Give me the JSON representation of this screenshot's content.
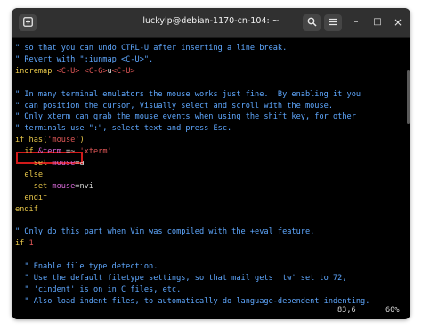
{
  "window": {
    "title": "luckylp@debian-1170-cn-104: ~",
    "new_tab_icon": "plus-box-icon",
    "search_icon": "search-icon",
    "menu_icon": "hamburger-menu-icon",
    "minimize_label": "–",
    "maximize_label": "□",
    "close_label": "×"
  },
  "colors": {
    "comment": "#5fa8ff",
    "keyword": "#e8c84a",
    "string": "#e05757",
    "option": "#d86ad8",
    "highlight_box": "#d11a1a"
  },
  "terminal": {
    "lines": [
      [
        {
          "t": "\" so that you can undo CTRL-U after inserting a line break.",
          "c": "comment"
        }
      ],
      [
        {
          "t": "\" Revert with \":iunmap <C-U>\".",
          "c": "comment"
        }
      ],
      [
        {
          "t": "inoremap",
          "c": "kw"
        },
        {
          "t": " ",
          "c": "op"
        },
        {
          "t": "<C-U>",
          "c": "map"
        },
        {
          "t": " ",
          "c": "op"
        },
        {
          "t": "<C-G>",
          "c": "map"
        },
        {
          "t": "u",
          "c": "op"
        },
        {
          "t": "<C-U>",
          "c": "map"
        }
      ],
      [
        {
          "t": "",
          "c": "op"
        }
      ],
      [
        {
          "t": "\" In many terminal emulators the mouse works just fine.  By enabling it you",
          "c": "comment"
        }
      ],
      [
        {
          "t": "\" can position the cursor, Visually select and scroll with the mouse.",
          "c": "comment"
        }
      ],
      [
        {
          "t": "\" Only xterm can grab the mouse events when using the shift key, for other",
          "c": "comment"
        }
      ],
      [
        {
          "t": "\" terminals use \":\", select text and press Esc.",
          "c": "comment"
        }
      ],
      [
        {
          "t": "if",
          "c": "kw"
        },
        {
          "t": " ",
          "c": "op"
        },
        {
          "t": "has(",
          "c": "kw"
        },
        {
          "t": "'mouse'",
          "c": "str"
        },
        {
          "t": ")",
          "c": "kw"
        }
      ],
      [
        {
          "t": "  if",
          "c": "kw"
        },
        {
          "t": " ",
          "c": "op"
        },
        {
          "t": "&term",
          "c": "var"
        },
        {
          "t": " =~ ",
          "c": "op"
        },
        {
          "t": "'xterm'",
          "c": "str"
        }
      ],
      [
        {
          "t": "    set",
          "c": "kw"
        },
        {
          "t": " ",
          "c": "op"
        },
        {
          "t": "mouse",
          "c": "opt"
        },
        {
          "t": "=a",
          "c": "op"
        }
      ],
      [
        {
          "t": "  else",
          "c": "kw"
        }
      ],
      [
        {
          "t": "    set",
          "c": "kw"
        },
        {
          "t": " ",
          "c": "op"
        },
        {
          "t": "mouse",
          "c": "opt"
        },
        {
          "t": "=nvi",
          "c": "op"
        }
      ],
      [
        {
          "t": "  endif",
          "c": "kw"
        }
      ],
      [
        {
          "t": "endif",
          "c": "kw"
        }
      ],
      [
        {
          "t": "",
          "c": "op"
        }
      ],
      [
        {
          "t": "\" Only do this part when Vim was compiled with the +eval feature.",
          "c": "comment"
        }
      ],
      [
        {
          "t": "if",
          "c": "kw"
        },
        {
          "t": " ",
          "c": "op"
        },
        {
          "t": "1",
          "c": "num"
        }
      ],
      [
        {
          "t": "",
          "c": "op"
        }
      ],
      [
        {
          "t": "  \" Enable file type detection.",
          "c": "comment"
        }
      ],
      [
        {
          "t": "  \" Use the default filetype settings, so that mail gets 'tw' set to 72,",
          "c": "comment"
        }
      ],
      [
        {
          "t": "  \" 'cindent' is on in C files, etc.",
          "c": "comment"
        }
      ],
      [
        {
          "t": "  \" Also load indent files, to automatically do language-dependent indenting.",
          "c": "comment"
        }
      ]
    ],
    "status_position": "83,6",
    "status_percent": "60%"
  }
}
